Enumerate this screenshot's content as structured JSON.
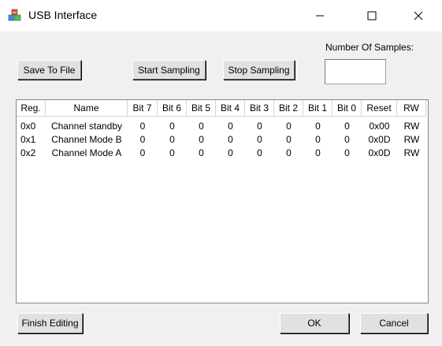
{
  "window": {
    "title": "USB Interface",
    "icon": "app-cubes-icon",
    "minimize_icon": "minimize-icon",
    "maximize_icon": "maximize-icon",
    "close_icon": "close-icon"
  },
  "toolbar": {
    "save_label": "Save To File",
    "start_label": "Start Sampling",
    "stop_label": "Stop Sampling",
    "samples_label": "Number Of Samples:",
    "samples_value": ""
  },
  "table": {
    "columns": [
      "Reg.",
      "Name",
      "Bit 7",
      "Bit 6",
      "Bit 5",
      "Bit 4",
      "Bit 3",
      "Bit 2",
      "Bit 1",
      "Bit 0",
      "Reset",
      "RW"
    ],
    "rows": [
      [
        "0x0",
        "Channel standby",
        "0",
        "0",
        "0",
        "0",
        "0",
        "0",
        "0",
        "0",
        "0x00",
        "RW"
      ],
      [
        "0x1",
        "Channel Mode B",
        "0",
        "0",
        "0",
        "0",
        "0",
        "0",
        "0",
        "0",
        "0x0D",
        "RW"
      ],
      [
        "0x2",
        "Channel Mode A",
        "0",
        "0",
        "0",
        "0",
        "0",
        "0",
        "0",
        "0",
        "0x0D",
        "RW"
      ]
    ]
  },
  "footer": {
    "finish_label": "Finish Editing",
    "ok_label": "OK",
    "cancel_label": "Cancel"
  }
}
